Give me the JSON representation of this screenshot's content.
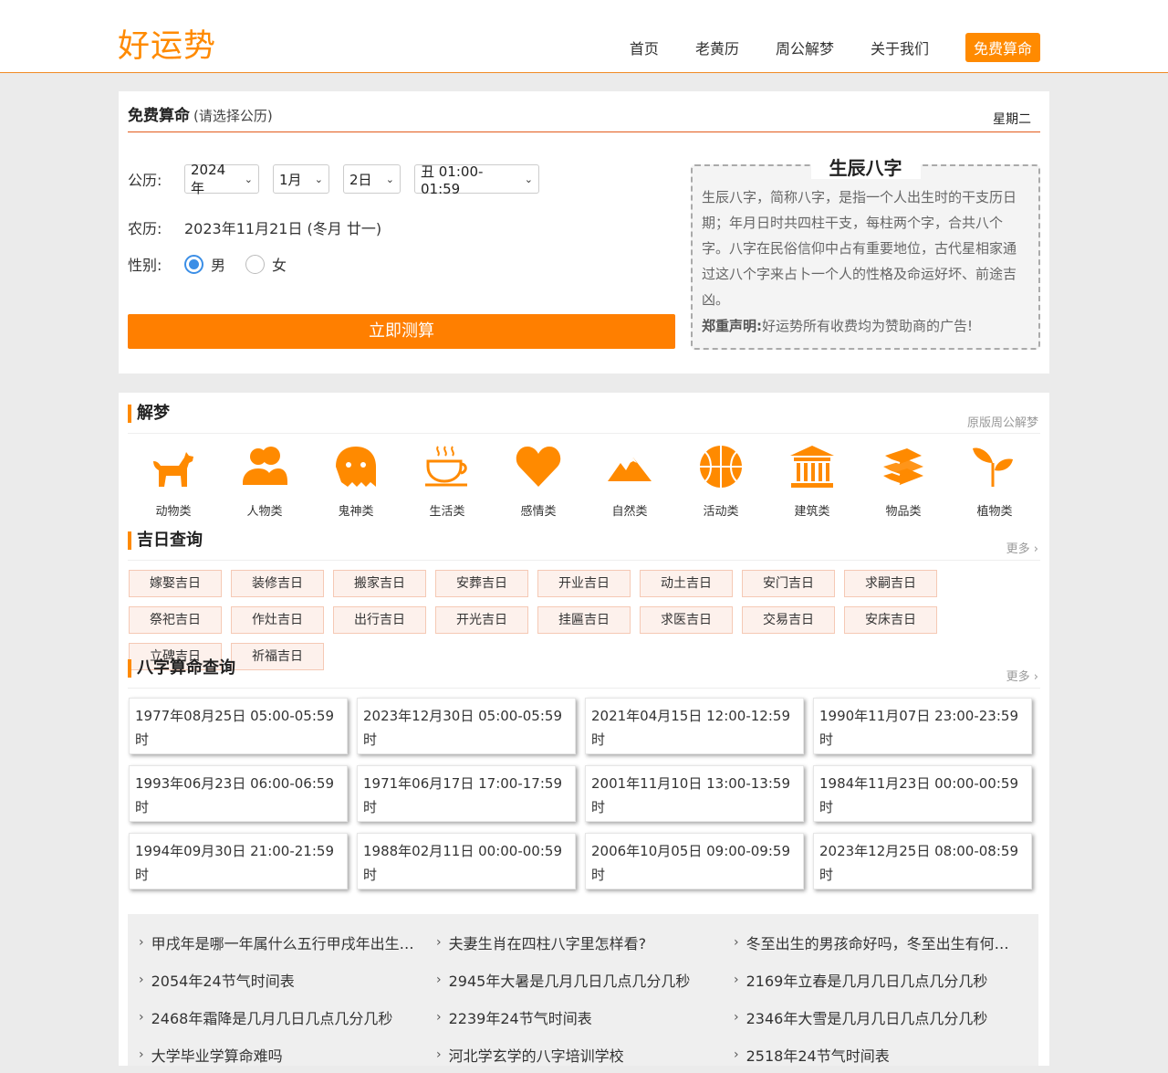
{
  "header": {
    "logo": "好运势",
    "nav": [
      "首页",
      "老黄历",
      "周公解梦",
      "关于我们"
    ],
    "cta": "免费算命"
  },
  "calc": {
    "title": "免费算命",
    "subtitle": "(请选择公历)",
    "weekday": "星期二",
    "solar_label": "公历:",
    "year": "2024年",
    "month": "1月",
    "day": "2日",
    "hour": "丑 01:00-01:59",
    "lunar_label": "农历:",
    "lunar_value": "2023年11月21日 (冬月 廿一)",
    "gender_label": "性别:",
    "male": "男",
    "female": "女",
    "gender_selected": "男",
    "submit": "立即测算"
  },
  "info": {
    "title": "生辰八字",
    "text": "生辰八字，简称八字，是指一个人出生时的干支历日期；年月日时共四柱干支，每柱两个字，合共八个字。八字在民俗信仰中占有重要地位，古代星相家通过这八个字来占卜一个人的性格及命运好坏、前途吉凶。",
    "note_bold": "郑重声明:",
    "note": "好运势所有收费均为赞助商的广告!"
  },
  "dream": {
    "title": "解梦",
    "more": "原版周公解梦",
    "categories": [
      {
        "label": "动物类",
        "icon": "dog-icon"
      },
      {
        "label": "人物类",
        "icon": "people-icon"
      },
      {
        "label": "鬼神类",
        "icon": "ghost-icon"
      },
      {
        "label": "生活类",
        "icon": "coffee-cup-icon"
      },
      {
        "label": "感情类",
        "icon": "heart-icon"
      },
      {
        "label": "自然类",
        "icon": "mountain-icon"
      },
      {
        "label": "活动类",
        "icon": "basketball-icon"
      },
      {
        "label": "建筑类",
        "icon": "building-icon"
      },
      {
        "label": "物品类",
        "icon": "books-icon"
      },
      {
        "label": "植物类",
        "icon": "plant-icon"
      }
    ]
  },
  "jiri": {
    "title": "吉日查询",
    "more": "更多",
    "tags": [
      "嫁娶吉日",
      "装修吉日",
      "搬家吉日",
      "安葬吉日",
      "开业吉日",
      "动土吉日",
      "安门吉日",
      "求嗣吉日",
      "祭祀吉日",
      "作灶吉日",
      "出行吉日",
      "开光吉日",
      "挂匾吉日",
      "求医吉日",
      "交易吉日",
      "安床吉日",
      "立碑吉日",
      "祈福吉日"
    ]
  },
  "bazi": {
    "title": "八字算命查询",
    "more": "更多",
    "cards": [
      "1977年08月25日 05:00-05:59时",
      "2023年12月30日 05:00-05:59时",
      "2021年04月15日 12:00-12:59时",
      "1990年11月07日 23:00-23:59时",
      "1993年06月23日 06:00-06:59时",
      "1971年06月17日 17:00-17:59时",
      "2001年11月10日 13:00-13:59时",
      "1984年11月23日 00:00-00:59时",
      "1994年09月30日 21:00-21:59时",
      "1988年02月11日 00:00-00:59时",
      "2006年10月05日 09:00-09:59时",
      "2023年12月25日 08:00-08:59时"
    ]
  },
  "articles": [
    "甲戌年是哪一年属什么五行甲戌年出生的人是什么命",
    "夫妻生肖在四柱八字里怎样看?",
    "冬至出生的男孩命好吗，冬至出生有何说法",
    "2054年24节气时间表",
    "2945年大暑是几月几日几点几分几秒",
    "2169年立春是几月几日几点几分几秒",
    "2468年霜降是几月几日几点几分几秒",
    "2239年24节气时间表",
    "2346年大雪是几月几日几点几分几秒",
    "大学毕业学算命难吗",
    "河北学玄学的八字培训学校",
    "2518年24节气时间表"
  ],
  "colors": {
    "accent": "#ff8a00",
    "button": "#ff7f00",
    "radio": "#3b8ee6"
  }
}
